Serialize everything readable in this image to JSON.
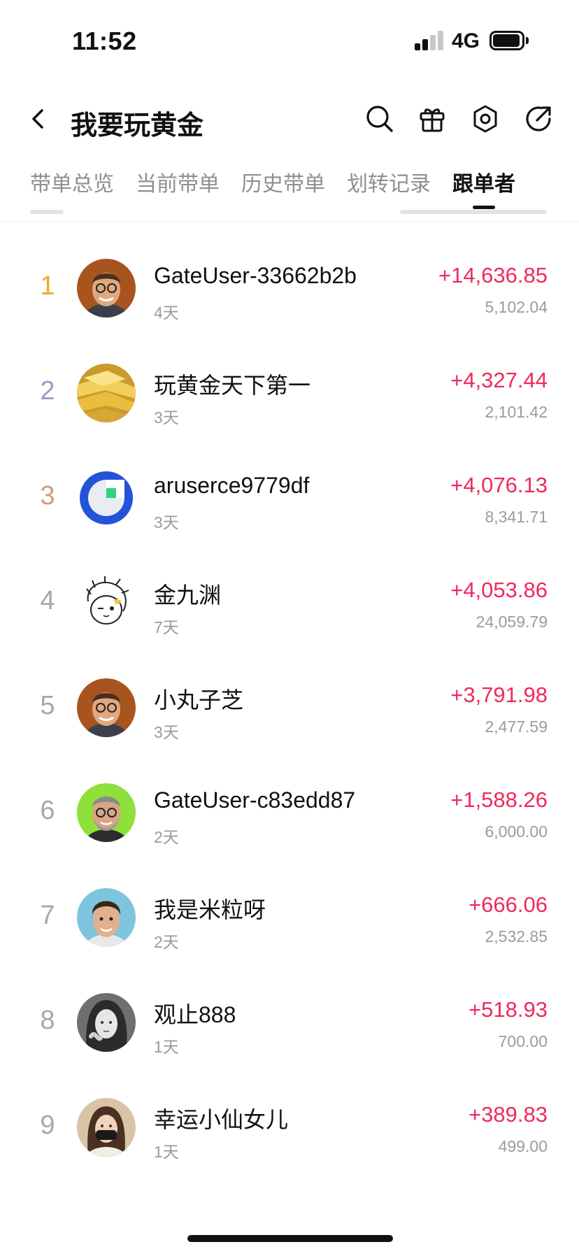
{
  "status_bar": {
    "time": "11:52",
    "network": "4G"
  },
  "header": {
    "title": "我要玩黄金"
  },
  "tabs": [
    {
      "label": "带单总览",
      "active": false
    },
    {
      "label": "当前带单",
      "active": false
    },
    {
      "label": "历史带单",
      "active": false
    },
    {
      "label": "划转记录",
      "active": false
    },
    {
      "label": "跟单者",
      "active": true
    }
  ],
  "followers": [
    {
      "rank": "1",
      "name": "GateUser-33662b2b",
      "days": "4天",
      "pnl": "+14,636.85",
      "amount": "5,102.04",
      "avatar": "man-glasses-orange"
    },
    {
      "rank": "2",
      "name": "玩黄金天下第一",
      "days": "3天",
      "pnl": "+4,327.44",
      "amount": "2,101.42",
      "avatar": "gold-bars"
    },
    {
      "rank": "3",
      "name": "aruserce9779df",
      "days": "3天",
      "pnl": "+4,076.13",
      "amount": "8,341.71",
      "avatar": "gate-logo"
    },
    {
      "rank": "4",
      "name": "金九渊",
      "days": "7天",
      "pnl": "+4,053.86",
      "amount": "24,059.79",
      "avatar": "anime-sketch"
    },
    {
      "rank": "5",
      "name": "小丸子芝",
      "days": "3天",
      "pnl": "+3,791.98",
      "amount": "2,477.59",
      "avatar": "man-glasses-orange"
    },
    {
      "rank": "6",
      "name": "GateUser-c83edd87",
      "days": "2天",
      "pnl": "+1,588.26",
      "amount": "6,000.00",
      "avatar": "man-beard-green"
    },
    {
      "rank": "7",
      "name": "我是米粒呀",
      "days": "2天",
      "pnl": "+666.06",
      "amount": "2,532.85",
      "avatar": "man-blue-bg"
    },
    {
      "rank": "8",
      "name": "观止888",
      "days": "1天",
      "pnl": "+518.93",
      "amount": "700.00",
      "avatar": "woman-bw"
    },
    {
      "rank": "9",
      "name": "幸运小仙女儿",
      "days": "1天",
      "pnl": "+389.83",
      "amount": "499.00",
      "avatar": "woman-mask"
    }
  ],
  "colors": {
    "profit": "#f0295c",
    "rank_gold": "#f5a623",
    "rank_silver": "#9a9ccc",
    "rank_bronze": "#d49a84",
    "rank_default": "#a7a7ad",
    "muted_text": "#9a9aa0"
  },
  "icons": [
    "back-icon",
    "search-icon",
    "gift-icon",
    "settings-icon",
    "share-icon"
  ]
}
